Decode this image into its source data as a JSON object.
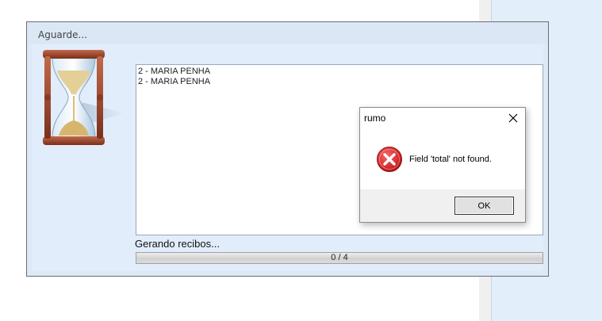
{
  "background": {
    "panel_color": "#e3eefb"
  },
  "wait_window": {
    "title": "Aguarde...",
    "icon": "hourglass-icon",
    "log_lines": [
      "2 - MARIA PENHA",
      "2 - MARIA PENHA"
    ],
    "status": "Gerando recibos...",
    "progress": {
      "text": "0 / 4",
      "current": 0,
      "total": 4
    }
  },
  "message_box": {
    "title": "rumo",
    "icon": "error-icon",
    "message": "Field 'total' not found.",
    "ok_label": "OK",
    "close_icon": "close-icon",
    "error_color": "#d62828"
  }
}
